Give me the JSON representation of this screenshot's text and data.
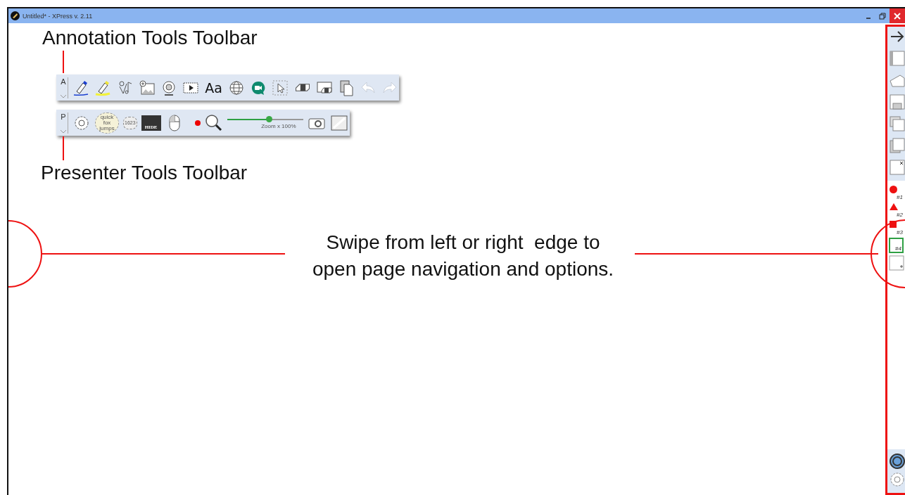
{
  "window": {
    "title": "Untitled* - XPress v. 2.11"
  },
  "callouts": [
    {
      "kind": "top",
      "text": "Annotation Tools Toolbar"
    },
    {
      "kind": "bottom",
      "text": "Presenter Tools Toolbar"
    }
  ],
  "hint": {
    "lines": [
      "Swipe from left or right  edge to",
      "open page navigation and options."
    ]
  },
  "annotation_toolbar": {
    "label": "A",
    "text_tool": "Aa",
    "undo": {
      "disabled": true
    },
    "redo": {
      "disabled": true
    }
  },
  "presenter_toolbar": {
    "label": "P",
    "text_sample": [
      "quick",
      "fox",
      "jumps"
    ],
    "counter": "1623",
    "hide_label": "HIDE",
    "zoom": {
      "level": 0.55,
      "reading": "Zoom x 100%"
    }
  },
  "pages": [
    {
      "label": "#1",
      "kind": "circle",
      "selected": false
    },
    {
      "label": "#2",
      "kind": "triangle",
      "selected": false
    },
    {
      "label": "#3",
      "kind": "square",
      "selected": false
    },
    {
      "label": "#4",
      "kind": "blank",
      "selected": true
    }
  ]
}
